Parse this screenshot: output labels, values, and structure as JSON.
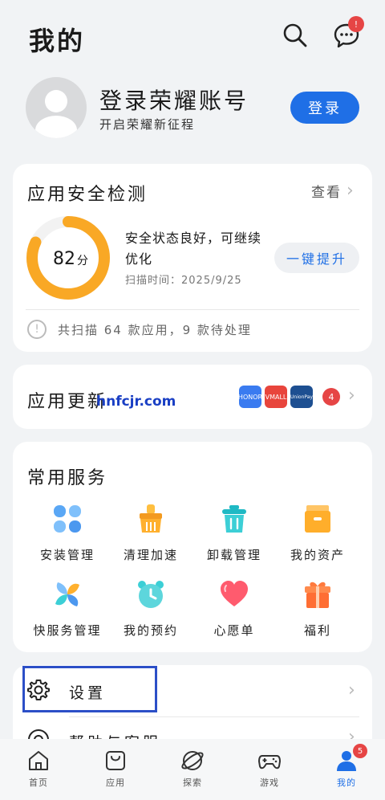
{
  "header": {
    "title": "我的",
    "message_badge": "!"
  },
  "account": {
    "title": "登录荣耀账号",
    "subtitle": "开启荣耀新征程",
    "login_label": "登录"
  },
  "security": {
    "title": "应用安全检测",
    "view_label": "查看",
    "score": "82",
    "score_unit": "分",
    "score_fraction": 0.82,
    "status": "安全状态良好，可继续优化",
    "scan_time": "扫描时间：2025/9/25",
    "upgrade_label": "一键提升",
    "summary": "共扫描 64 款应用，9 款待处理"
  },
  "updates": {
    "title": "应用更新",
    "apps": [
      {
        "name": "HONOR",
        "color": "#3a7bf0"
      },
      {
        "name": "VMALL",
        "color": "#e8453c"
      },
      {
        "name": "UnionPay",
        "color": "#1d4f91"
      }
    ],
    "count": "4"
  },
  "watermark": "hnfcjr.com",
  "services": {
    "title": "常用服务",
    "items": [
      {
        "label": "安装管理",
        "icon": "install-manager-icon"
      },
      {
        "label": "清理加速",
        "icon": "clean-broom-icon"
      },
      {
        "label": "卸载管理",
        "icon": "uninstall-trash-icon"
      },
      {
        "label": "我的资产",
        "icon": "assets-box-icon"
      },
      {
        "label": "快服务管理",
        "icon": "quick-service-icon"
      },
      {
        "label": "我的预约",
        "icon": "alarm-clock-icon"
      },
      {
        "label": "心愿单",
        "icon": "heart-icon"
      },
      {
        "label": "福利",
        "icon": "gift-icon"
      }
    ]
  },
  "settings": {
    "label": "设置",
    "help_label": "帮助与客服"
  },
  "nav": {
    "items": [
      {
        "label": "首页",
        "icon": "home-icon"
      },
      {
        "label": "应用",
        "icon": "bag-icon"
      },
      {
        "label": "探索",
        "icon": "planet-icon"
      },
      {
        "label": "游戏",
        "icon": "gamepad-icon"
      },
      {
        "label": "我的",
        "icon": "person-icon"
      }
    ],
    "badge": "5"
  },
  "colors": {
    "accent": "#1f6fe6",
    "badge": "#e64545",
    "ring": "#f9a825",
    "highlight": "#2c4fc7"
  }
}
